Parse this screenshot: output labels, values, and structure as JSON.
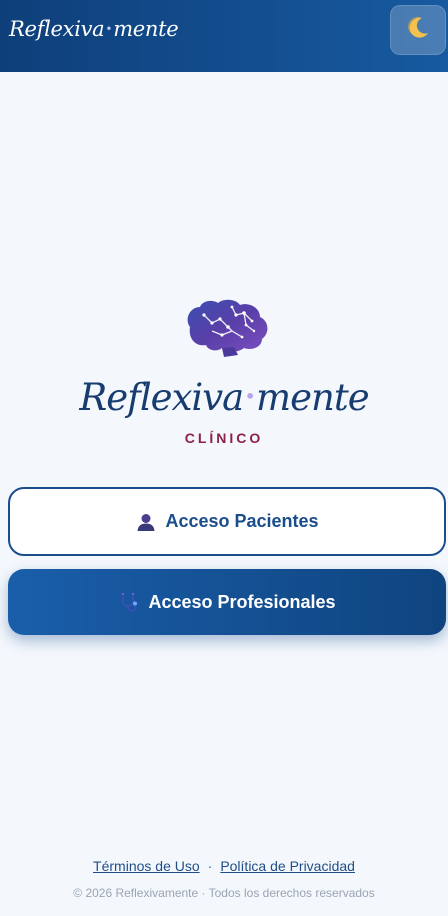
{
  "header": {
    "logo_part1": "Reflexiva",
    "logo_dot": "•",
    "logo_part2": "mente",
    "theme_toggle_icon": "moon-icon"
  },
  "brand": {
    "icon": "brain-icon",
    "name_part1": "Reflexiva",
    "name_dot": "•",
    "name_part2": "mente",
    "subtitle": "CLÍNICO"
  },
  "actions": {
    "patients_label": "Acceso Pacientes",
    "patients_icon": "user-icon",
    "professionals_label": "Acceso Profesionales",
    "professionals_icon": "stethoscope-icon"
  },
  "footer": {
    "terms_label": "Términos de Uso",
    "separator": "·",
    "privacy_label": "Política de Privacidad",
    "copyright": "© 2026 Reflexivamente · Todos los derechos reservados"
  },
  "colors": {
    "header_start": "#0e3f7a",
    "header_end": "#175aa0",
    "primary": "#1a4d8c",
    "accent": "#8c2248",
    "background": "#f4f8fd"
  }
}
